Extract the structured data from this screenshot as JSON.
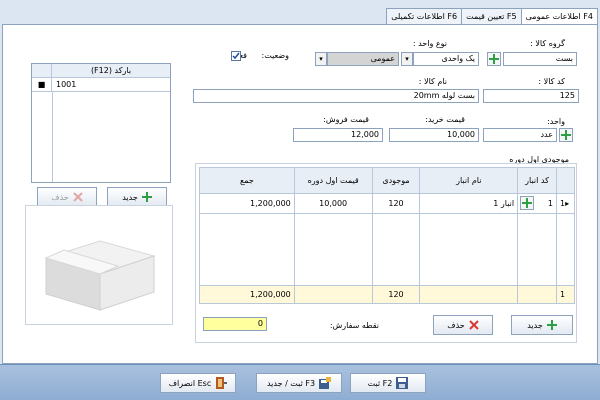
{
  "tabs": [
    "اطلاعات عمومی F4",
    "تعیین قیمت F5",
    "اطلاعات تکمیلی F6"
  ],
  "form": {
    "group_label": "گروه کالا :",
    "group_value": "بست",
    "unit_type_label": "نوع واحد :",
    "unit_type_value": "یک واحدی",
    "general_value": "عمومی",
    "status_label": "وضعیت:",
    "active_label": "فعال",
    "code_label": "کد کالا :",
    "code_value": "125",
    "name_label": "نام کالا :",
    "name_value": "بست لوله 20mm",
    "unit_label": "واحد:",
    "unit_value": "عدد",
    "buy_label": "قیمت خرید:",
    "buy_value": "10,000",
    "sell_label": "قیمت فروش:",
    "sell_value": "12,000"
  },
  "barcode": {
    "header": "(F12) بارکد",
    "rows": [
      "1001"
    ],
    "new_label": "جدید",
    "delete_label": "حذف"
  },
  "stock": {
    "title": "موجودی اول دوره",
    "columns": [
      "کد انبار",
      "نام انبار",
      "موجودی",
      "قیمت اول دوره",
      "جمع"
    ],
    "rows": [
      {
        "index": "1",
        "code": "1",
        "warehouse": "انبار 1",
        "qty": "120",
        "price": "10,000",
        "total": "1,200,000"
      }
    ],
    "footer": {
      "index": "1",
      "qty": "120",
      "total": "1,200,000"
    },
    "new_label": "جدید",
    "delete_label": "حذف",
    "reorder_label": "نقطه سفارش:",
    "reorder_value": "0"
  },
  "footer_buttons": {
    "save": "ثبت F2",
    "save_new": "ثبت / جدید F3",
    "cancel": "انصراف Esc"
  },
  "colors": {
    "accent": "#8da2bd",
    "yellow": "#ffff9e",
    "plus": "#2ea043",
    "delete": "#d9382e"
  }
}
